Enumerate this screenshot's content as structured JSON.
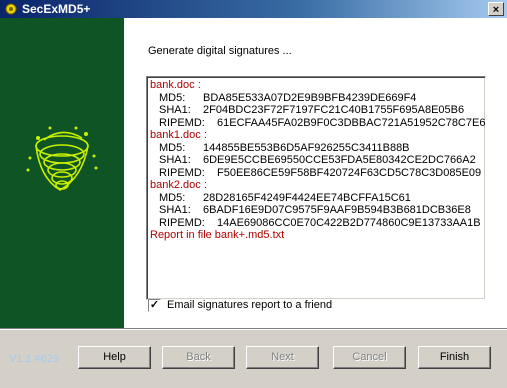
{
  "window": {
    "title": "SecExMD5+",
    "close_label": "×"
  },
  "main": {
    "heading": "Generate digital signatures ...",
    "files": [
      {
        "name": "bank.doc :",
        "hashes": [
          {
            "label": "MD5:",
            "value": "BDA85E533A07D2E9B9BFB4239DE669F4"
          },
          {
            "label": "SHA1:",
            "value": "2F04BDC23F72F7197FC21C40B1755F695A8E05B6"
          },
          {
            "label": "RIPEMD:",
            "value": "61ECFAA45FA02B9F0C3DBBAC721A51952C78C7E6"
          }
        ]
      },
      {
        "name": "bank1.doc :",
        "hashes": [
          {
            "label": "MD5:",
            "value": "144855BE553B6D5AF926255C3411B88B"
          },
          {
            "label": "SHA1:",
            "value": "6DE9E5CCBE69550CCE53FDA5E80342CE2DC766A2"
          },
          {
            "label": "RIPEMD:",
            "value": "F50EE86CE59F58BF420724F63CD5C78C3D085E09"
          }
        ]
      },
      {
        "name": "bank2.doc :",
        "hashes": [
          {
            "label": "MD5:",
            "value": "28D28165F4249F4424EE74BCFFA15C61"
          },
          {
            "label": "SHA1:",
            "value": "6BADF16E9D07C9575F9AAF9B594B3B681DCB36E8"
          },
          {
            "label": "RIPEMD:",
            "value": "14AE69086CC0E70C422B2D774860C9E13733AA1B"
          }
        ]
      }
    ],
    "report_line": "Report in file bank+.md5.txt",
    "email_checkbox": {
      "label": "Email signatures report to a friend",
      "checked": true
    }
  },
  "footer": {
    "version": "V1.1 #629",
    "buttons": [
      {
        "label": "Help",
        "enabled": true
      },
      {
        "label": "Back",
        "enabled": false
      },
      {
        "label": "Next",
        "enabled": false
      },
      {
        "label": "Cancel",
        "enabled": false
      },
      {
        "label": "Finish",
        "enabled": true
      }
    ]
  },
  "colors": {
    "sidebar": "#0f5424",
    "logo": "#c8f000",
    "file_name": "#b00000",
    "title_gradient_start": "#0a246a",
    "version_text": "#a6caf0"
  },
  "icons": {
    "window": "gear-icon",
    "sidebar": "spiral-logo-icon"
  }
}
